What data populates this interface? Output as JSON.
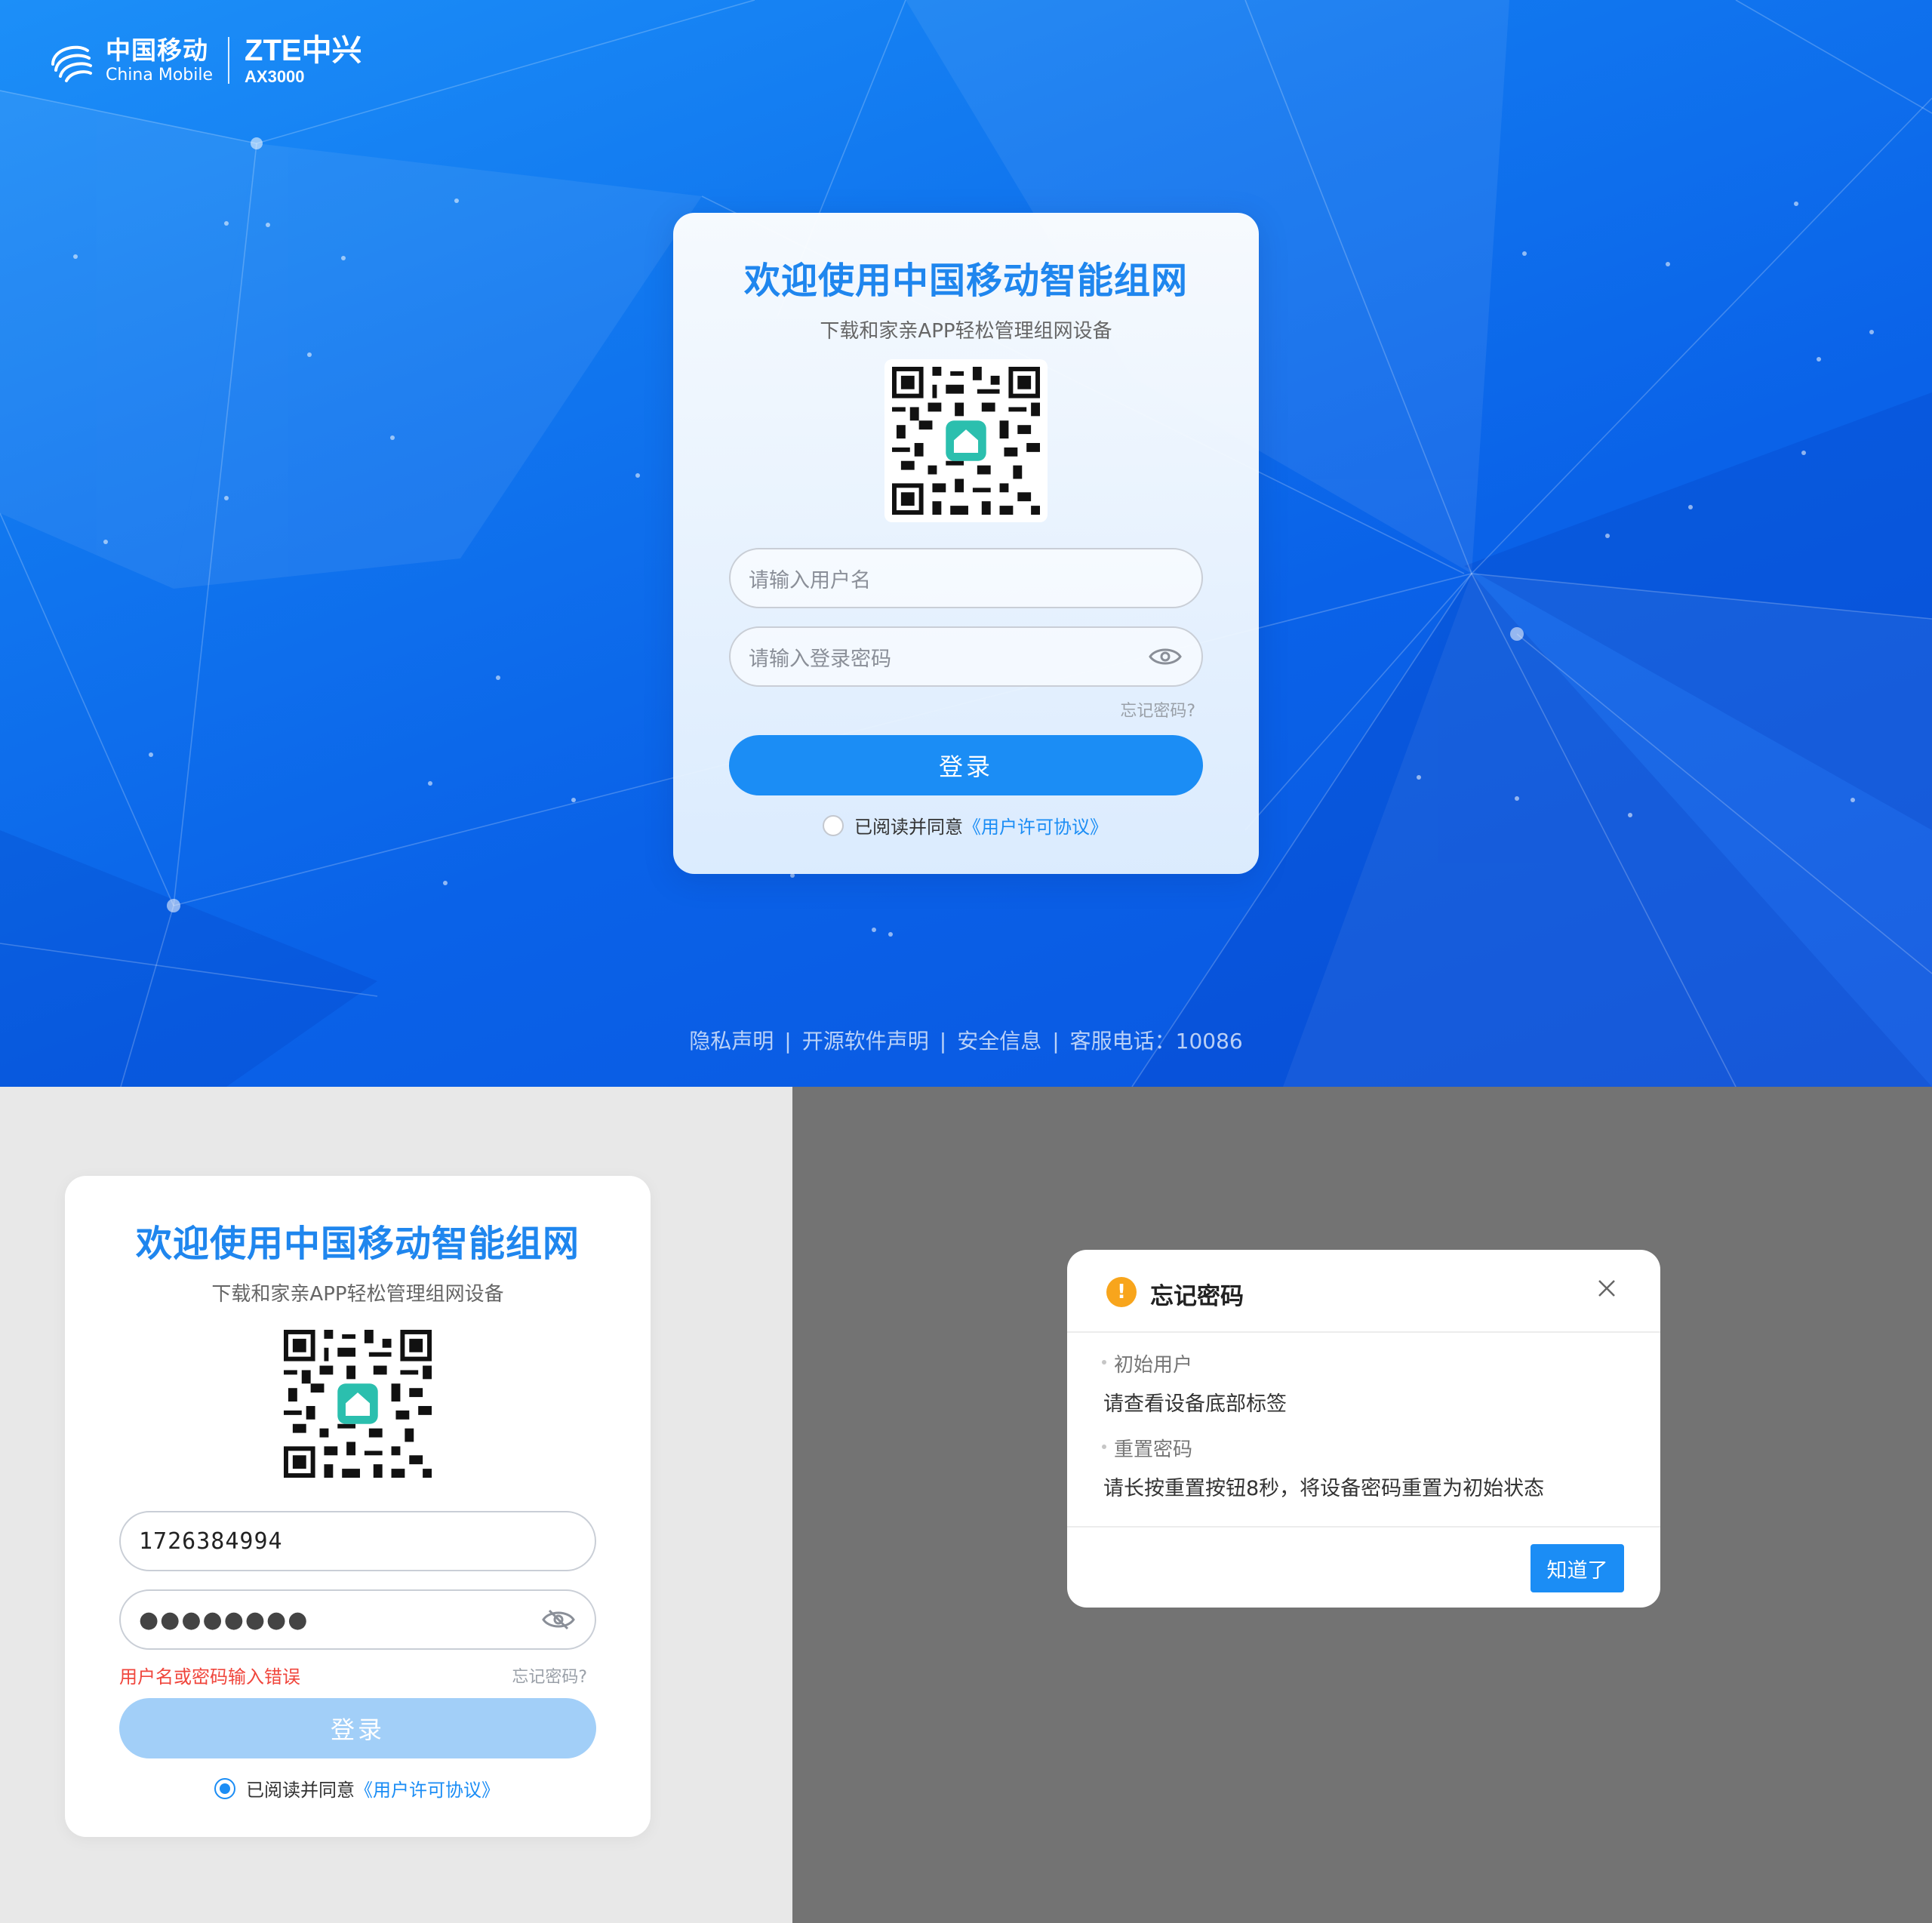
{
  "brand": {
    "operator_zh": "中国移动",
    "operator_en": "China Mobile",
    "vendor": "ZTE中兴",
    "model": "AX3000"
  },
  "login": {
    "title": "欢迎使用中国移动智能组网",
    "subtitle": "下载和家亲APP轻松管理组网设备",
    "username_placeholder": "请输入用户名",
    "password_placeholder": "请输入登录密码",
    "forgot": "忘记密码?",
    "submit": "登录",
    "agree_text": "已阅读并同意",
    "agree_link": "《用户许可协议》"
  },
  "footer": {
    "items": [
      "隐私声明",
      "开源软件声明",
      "安全信息",
      "客服电话：10086"
    ]
  },
  "error_state": {
    "title": "欢迎使用中国移动智能组网",
    "subtitle": "下载和家亲APP轻松管理组网设备",
    "username_value": "1726384994",
    "password_mask": "●●●●●●●●",
    "error_message": "用户名或密码输入错误",
    "forgot": "忘记密码?",
    "submit": "登录",
    "agree_text": "已阅读并同意",
    "agree_link": "《用户许可协议》",
    "agree_checked": true
  },
  "dialog": {
    "title": "忘记密码",
    "section1_label": "初始用户",
    "section1_text": "请查看设备底部标签",
    "section2_label": "重置密码",
    "section2_text": "请长按重置按钮8秒，将设备密码重置为初始状态",
    "confirm": "知道了"
  },
  "colors": {
    "primary": "#1b8df5",
    "title_blue": "#1f86ee",
    "error": "#f0463c",
    "warning": "#f8a51c",
    "hero_bg": "#1177ef",
    "overlay": "#737373"
  },
  "icons": [
    "china-mobile-logo-icon",
    "qr-code-icon",
    "app-logo-icon",
    "eye-icon",
    "warning-icon",
    "close-icon"
  ]
}
